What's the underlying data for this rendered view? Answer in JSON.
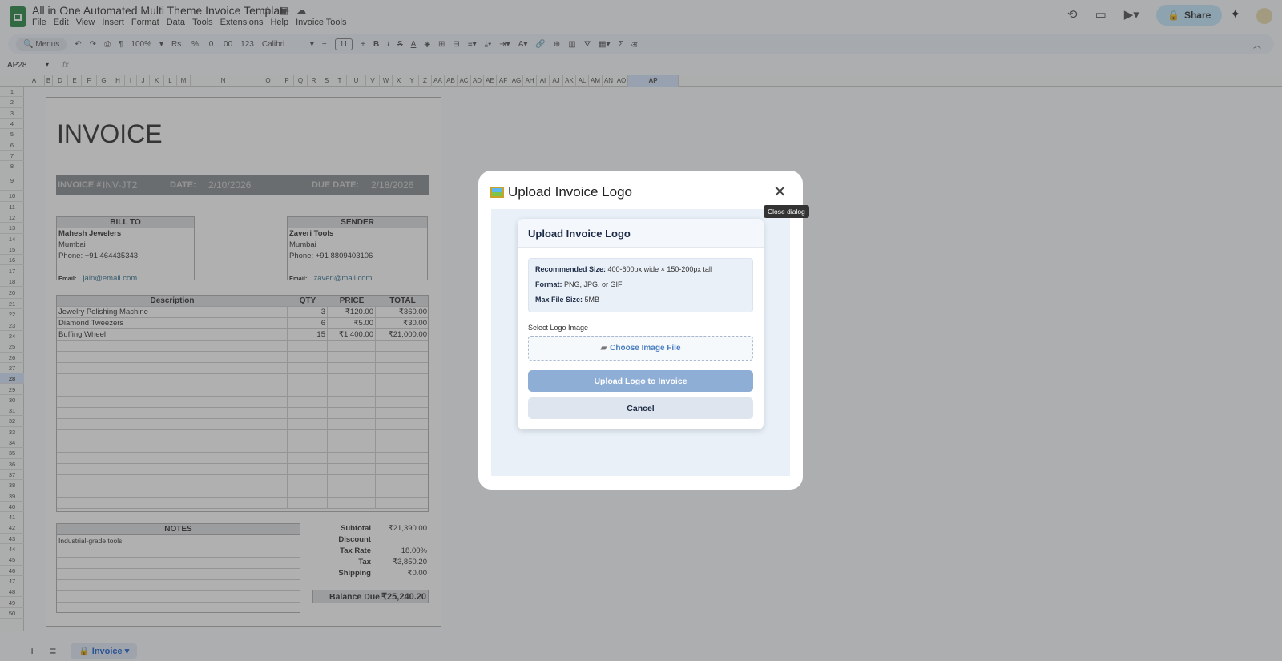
{
  "app": {
    "title": "All in One Automated Multi Theme Invoice Template",
    "menus": [
      "File",
      "Edit",
      "View",
      "Insert",
      "Format",
      "Data",
      "Tools",
      "Extensions",
      "Help",
      "Invoice Tools"
    ],
    "share_label": "Share"
  },
  "toolbar": {
    "search": "Menus",
    "zoom": "100%",
    "currency": "Rs.",
    "percent": "%",
    "dec_less": ".0",
    "dec_more": ".00",
    "format_123": "123",
    "font": "Calibri",
    "font_size": "11",
    "hindi": "अ"
  },
  "formula_bar": {
    "cell_ref": "AP28",
    "fx": "fx",
    "value": ""
  },
  "columns": [
    "A",
    "B",
    "D",
    "E",
    "F",
    "G",
    "H",
    "I",
    "J",
    "K",
    "L",
    "M",
    "N",
    "O",
    "P",
    "Q",
    "R",
    "S",
    "T",
    "U",
    "V",
    "W",
    "X",
    "Y",
    "Z",
    "AA",
    "AB",
    "AC",
    "AD",
    "AE",
    "AF",
    "AG",
    "AH",
    "AI",
    "AJ",
    "AK",
    "AL",
    "AM",
    "AN",
    "AO",
    "AP"
  ],
  "rows": [
    "1",
    "2",
    "3",
    "4",
    "5",
    "6",
    "7",
    "8",
    "9",
    "10",
    "11",
    "12",
    "13",
    "14",
    "15",
    "16",
    "17",
    "18",
    "20",
    "21",
    "22",
    "23",
    "24",
    "25",
    "26",
    "27",
    "28",
    "29",
    "30",
    "31",
    "32",
    "33",
    "34",
    "35",
    "36",
    "37",
    "38",
    "39",
    "40",
    "41",
    "42",
    "43",
    "44",
    "45",
    "46",
    "47",
    "48",
    "49",
    "50"
  ],
  "invoice": {
    "heading": "INVOICE",
    "invoice_label": "INVOICE #",
    "invoice_no": "INV-JT2",
    "date_label": "DATE:",
    "date": "2/10/2026",
    "due_label": "DUE DATE:",
    "due_date": "2/18/2026",
    "bill_to": {
      "header": "BILL TO",
      "name": "Mahesh Jewelers",
      "city": "Mumbai",
      "phone": "Phone: +91 464435343",
      "email_label": "Email:",
      "email": "jain@email.com"
    },
    "sender": {
      "header": "SENDER",
      "name": "Zaveri Tools",
      "city": "Mumbai",
      "phone": "Phone: +91 8809403106",
      "email_label": "Email:",
      "email": "zaveri@mail.com"
    },
    "items_header": {
      "description": "Description",
      "qty": "QTY",
      "price": "PRICE",
      "total": "TOTAL"
    },
    "items": [
      {
        "description": "Jewelry Polishing Machine",
        "qty": "3",
        "price": "₹120.00",
        "total": "₹360.00"
      },
      {
        "description": "Diamond Tweezers",
        "qty": "6",
        "price": "₹5.00",
        "total": "₹30.00"
      },
      {
        "description": "Buffing Wheel",
        "qty": "15",
        "price": "₹1,400.00",
        "total": "₹21,000.00"
      }
    ],
    "notes_header": "NOTES",
    "notes": "Industrial-grade tools.",
    "totals": [
      {
        "label": "Subtotal",
        "value": "₹21,390.00"
      },
      {
        "label": "Discount",
        "value": ""
      },
      {
        "label": "Tax Rate",
        "value": "18.00%"
      },
      {
        "label": "Tax",
        "value": "₹3,850.20"
      },
      {
        "label": "Shipping",
        "value": "₹0.00"
      }
    ],
    "balance_label": "Balance Due",
    "balance": "₹25,240.20"
  },
  "sheet_tab": "Invoice",
  "dialog": {
    "title": "Upload Invoice Logo",
    "close_tooltip": "Close dialog",
    "card_title": "Upload Invoice Logo",
    "rec_label": "Recommended Size:",
    "rec_value": " 400-600px wide × 150-200px tall",
    "format_label": "Format:",
    "format_value": " PNG, JPG, or GIF",
    "max_label": "Max File Size:",
    "max_value": " 5MB",
    "select_label": "Select Logo Image",
    "choose_label": "Choose Image File",
    "upload_label": "Upload Logo to Invoice",
    "cancel_label": "Cancel"
  }
}
